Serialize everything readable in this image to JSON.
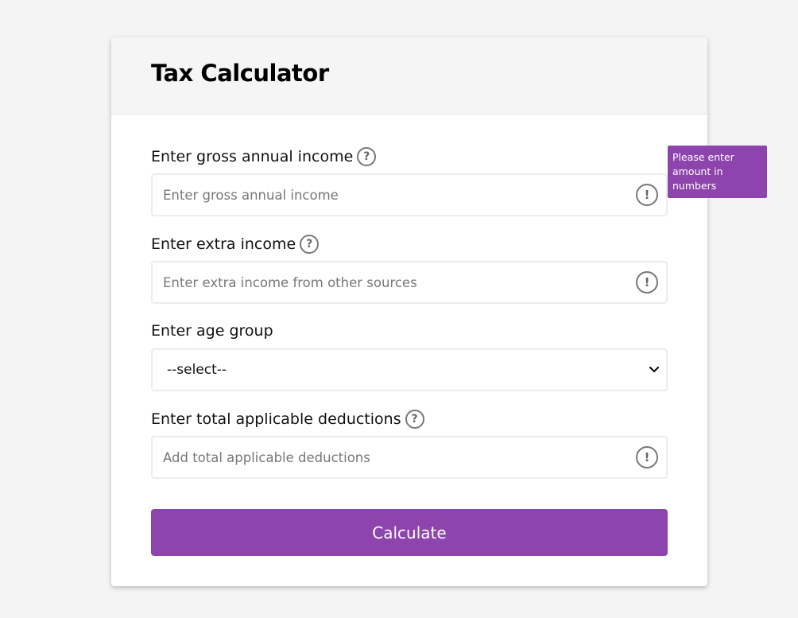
{
  "form": {
    "title": "Tax Calculator",
    "fields": {
      "gross_income": {
        "label": "Enter gross annual income",
        "placeholder": "Enter gross annual income",
        "help_icon": "?",
        "warning_icon": "!"
      },
      "extra_income": {
        "label": "Enter extra income",
        "placeholder": "Enter extra income from other sources",
        "help_icon": "?",
        "warning_icon": "!"
      },
      "age_group": {
        "label": "Enter age group",
        "selected": "--select--"
      },
      "deductions": {
        "label": "Enter total applicable deductions",
        "placeholder": "Add total applicable deductions",
        "help_icon": "?",
        "warning_icon": "!"
      }
    },
    "submit_label": "Calculate"
  },
  "tooltip": {
    "text": "Please enter amount in numbers"
  },
  "colors": {
    "accent": "#8e44ad",
    "page_background": "#f4f4f4",
    "header_background": "#f5f5f5"
  }
}
